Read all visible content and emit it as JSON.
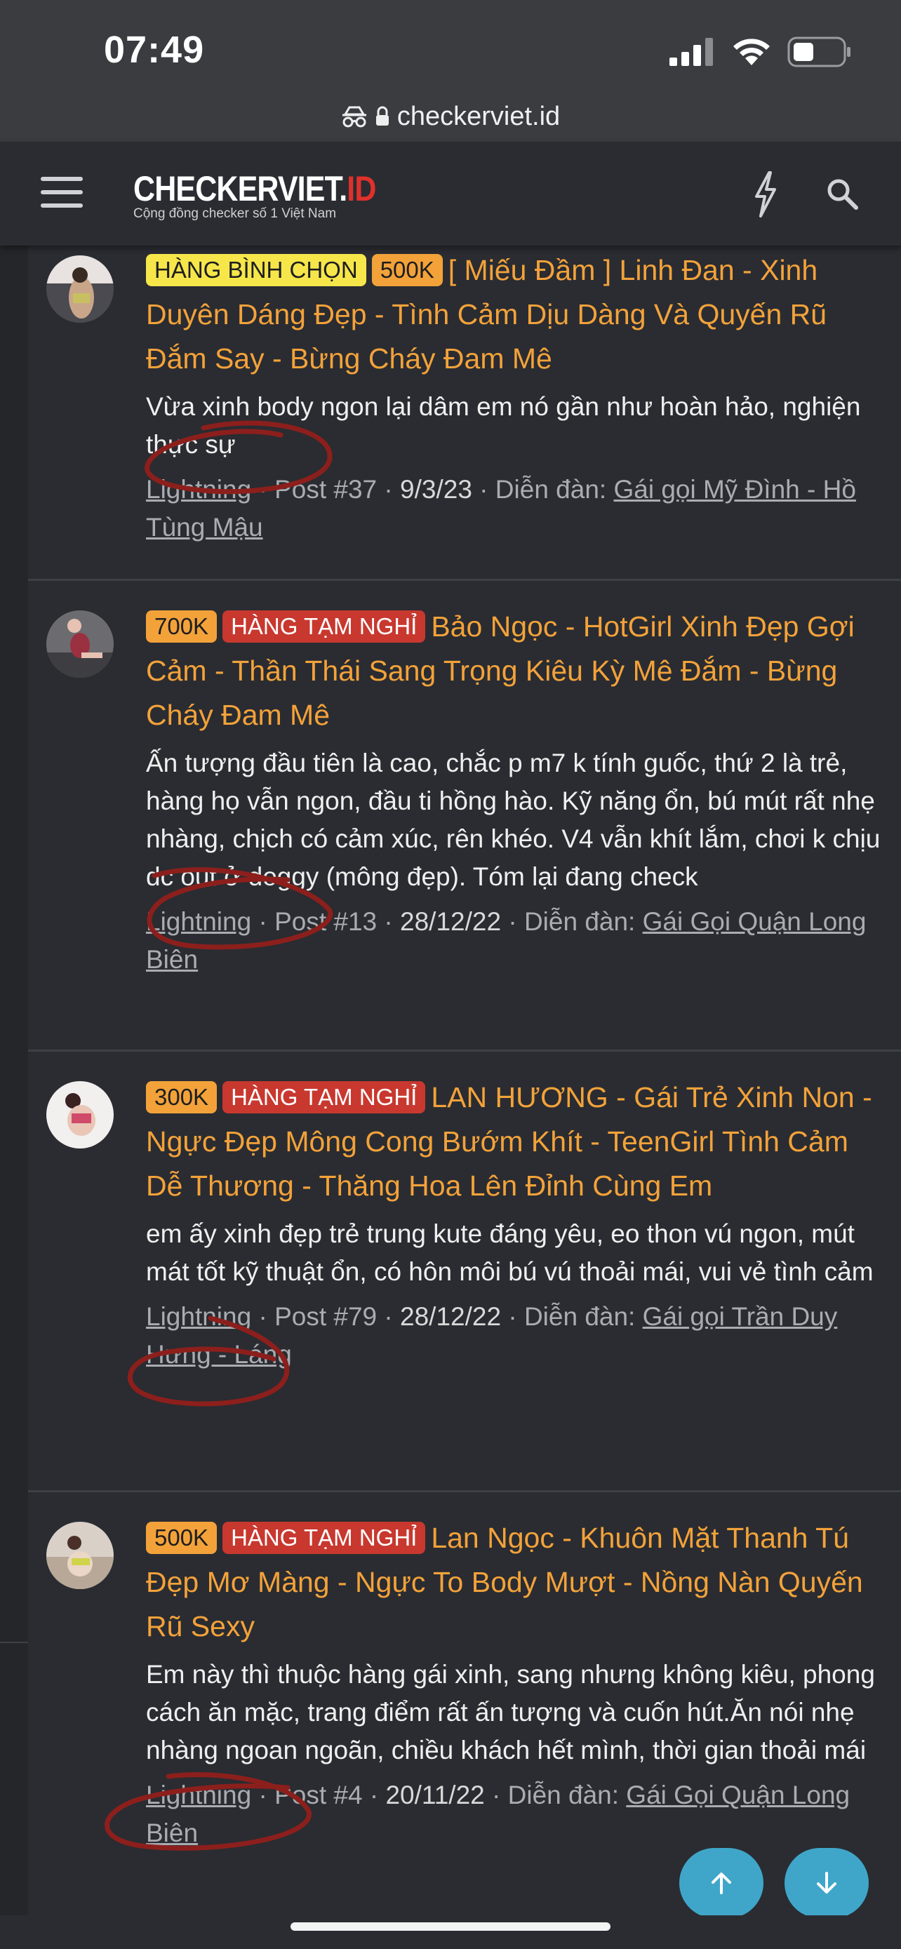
{
  "status": {
    "time": "07:49"
  },
  "browser": {
    "url": "checkerviet.id"
  },
  "header": {
    "logo_main": "CHECKERVIET.",
    "logo_accent": "ID",
    "tagline": "Cộng đồng checker số 1 Việt Nam"
  },
  "colors": {
    "accent": "#f3a23a",
    "badge_red": "#c8382f",
    "badge_yellow": "#f6e64a",
    "fab": "#3fa6c9",
    "annotation": "#8c1f1c"
  },
  "posts": [
    {
      "badges": [
        {
          "text": "HÀNG BÌNH CHỌN",
          "style": "yellow"
        },
        {
          "text": "500K",
          "style": "orange"
        }
      ],
      "title": "[ Miếu Đầm ] Linh Đan - Xinh Duyên Dáng Đẹp - Tình Cảm Dịu Dàng Và Quyến Rũ Đắm Say - Bừng Cháy Đam Mê",
      "snippet": "Vừa xinh body ngon lại dâm em nó gần như hoàn hảo, nghiện thực sự",
      "author": "Lightning",
      "post_no": "Post #37",
      "date": "9/3/23",
      "forum_label": "Diễn đàn:",
      "forum": "Gái gọi Mỹ Đình - Hồ Tùng Mậu"
    },
    {
      "badges": [
        {
          "text": "700K",
          "style": "orange"
        },
        {
          "text": "HÀNG TẠM NGHỈ",
          "style": "red"
        }
      ],
      "title": "Bảo Ngọc - HotGirl Xinh Đẹp Gợi Cảm - Thần Thái Sang Trọng Kiêu Kỳ Mê Đắm - Bừng Cháy Đam Mê",
      "snippet": "Ấn tượng đầu tiên là cao, chắc p m7 k tính guốc, thứ 2 là trẻ, hàng họ vẫn ngon, đầu ti hồng hào. Kỹ năng ổn, bú mút rất nhẹ nhàng, chịch có cảm xúc, rên khéo. V4 vẫn khít lắm, chơi k chịu dc out ở doggy (mông đẹp). Tóm lại đang check",
      "author": "Lightning",
      "post_no": "Post #13",
      "date": "28/12/22",
      "forum_label": "Diễn đàn:",
      "forum": "Gái Gọi Quận Long Biên"
    },
    {
      "badges": [
        {
          "text": "300K",
          "style": "orange"
        },
        {
          "text": "HÀNG TẠM NGHỈ",
          "style": "red"
        }
      ],
      "title": "LAN HƯƠNG - Gái Trẻ Xinh Non - Ngực Đẹp Mông Cong Bướm Khít - TeenGirl Tình Cảm Dễ Thương - Thăng Hoa Lên Đỉnh Cùng Em",
      "snippet": "em ấy xinh đẹp trẻ trung kute đáng yêu, eo thon vú ngon, mút mát tốt kỹ thuật ổn, có hôn môi bú vú thoải mái, vui vẻ tình cảm",
      "author": "Lightning",
      "post_no": "Post #79",
      "date": "28/12/22",
      "forum_label": "Diễn đàn:",
      "forum": "Gái gọi Trần Duy Hưng - Láng"
    },
    {
      "badges": [
        {
          "text": "500K",
          "style": "orange"
        },
        {
          "text": "HÀNG TẠM NGHỈ",
          "style": "red"
        }
      ],
      "title": "Lan Ngọc - Khuôn Mặt Thanh Tú Đẹp Mơ Màng - Ngực To Body Mượt - Nồng Nàn Quyến Rũ Sexy",
      "snippet": "Em này thì thuộc hàng gái xinh, sang nhưng không kiêu, phong cách ăn mặc, trang điểm rất ấn tượng và cuốn hút.Ăn nói nhẹ nhàng ngoan ngoãn, chiều khách hết mình, thời gian thoải mái",
      "author": "Lightning",
      "post_no": "Post #4",
      "date": "20/11/22",
      "forum_label": "Diễn đàn:",
      "forum": "Gái Gọi Quận Long Biên"
    }
  ]
}
